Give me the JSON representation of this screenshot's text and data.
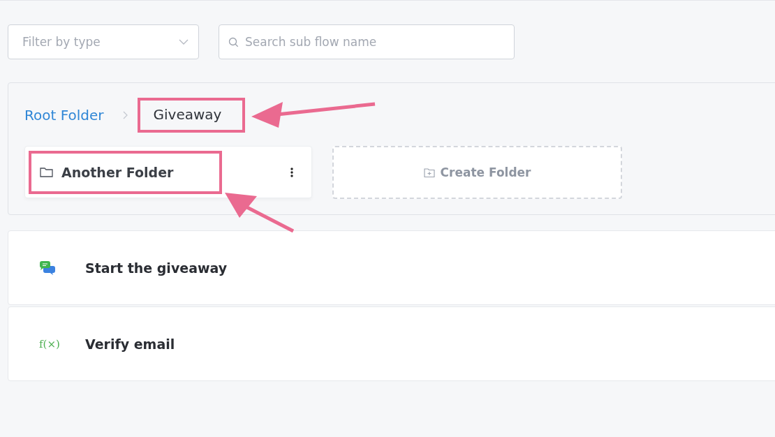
{
  "filters": {
    "type_select": {
      "placeholder": "Filter by type"
    },
    "search": {
      "placeholder": "Search sub flow name"
    }
  },
  "breadcrumb": [
    {
      "label": "Root Folder",
      "current": false,
      "highlighted": false
    },
    {
      "label": "Giveaway",
      "current": true,
      "highlighted": true
    }
  ],
  "folders": [
    {
      "name": "Another Folder",
      "highlighted": true
    }
  ],
  "create_folder": {
    "label": "Create Folder"
  },
  "flows": [
    {
      "kind": "chat",
      "name": "Start the giveaway"
    },
    {
      "kind": "function",
      "icon_text": "f(×)",
      "name": "Verify email"
    }
  ]
}
